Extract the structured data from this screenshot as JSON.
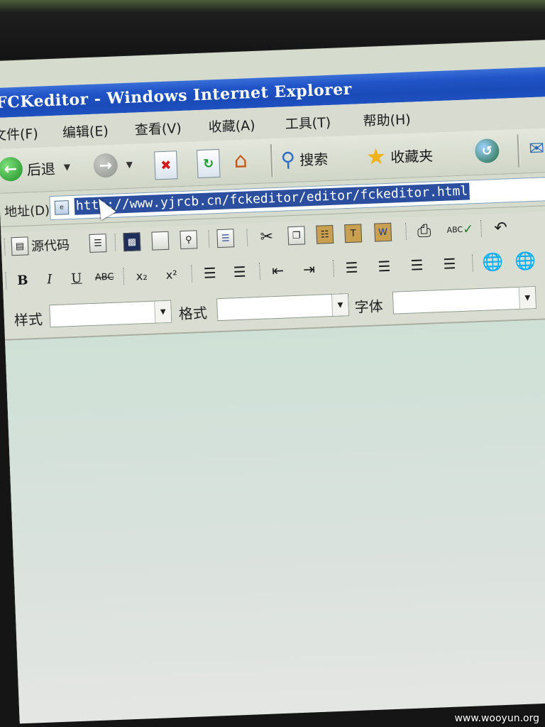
{
  "window": {
    "title": "FCKeditor - Windows Internet Explorer"
  },
  "menu": {
    "items": [
      "文件(F)",
      "编辑(E)",
      "查看(V)",
      "收藏(A)",
      "工具(T)",
      "帮助(H)"
    ]
  },
  "nav_toolbar": {
    "back_label": "后退",
    "search_label": "搜索",
    "favorites_label": "收藏夹"
  },
  "address": {
    "label": "地址(D)",
    "url": "http://www.yjrcb.cn/fckeditor/editor/fckeditor.html"
  },
  "editor_toolbar": {
    "source_label": "源代码",
    "bold": "B",
    "italic": "I",
    "underline": "U",
    "strike": "ABC",
    "subscript": "x₂",
    "superscript": "x²",
    "spell": "ABC",
    "style_label": "样式",
    "format_label": "格式",
    "font_label": "字体",
    "style_value": "",
    "format_value": "",
    "font_value": ""
  },
  "watermark": "www.wooyun.org"
}
